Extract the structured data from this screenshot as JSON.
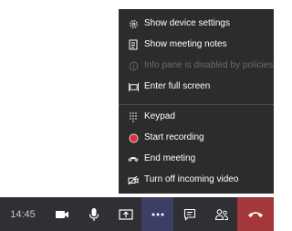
{
  "menu": {
    "items": [
      {
        "label": "Show device settings",
        "icon": "gear-icon",
        "enabled": true
      },
      {
        "label": "Show meeting notes",
        "icon": "notes-icon",
        "enabled": true
      },
      {
        "label": "Info pane is disabled by policies",
        "icon": "info-icon",
        "enabled": false
      },
      {
        "label": "Enter full screen",
        "icon": "fullscreen-icon",
        "enabled": true
      },
      {
        "label": "Keypad",
        "icon": "keypad-icon",
        "enabled": true
      },
      {
        "label": "Start recording",
        "icon": "record-icon",
        "enabled": true
      },
      {
        "label": "End meeting",
        "icon": "end-meeting-icon",
        "enabled": true
      },
      {
        "label": "Turn off incoming video",
        "icon": "video-off-icon",
        "enabled": true
      }
    ]
  },
  "callbar": {
    "time": "14:45",
    "controls": [
      {
        "icon": "camera-icon"
      },
      {
        "icon": "microphone-icon"
      },
      {
        "icon": "share-screen-icon"
      },
      {
        "icon": "more-options-icon"
      },
      {
        "icon": "chat-icon"
      },
      {
        "icon": "participants-icon"
      },
      {
        "icon": "hang-up-icon"
      }
    ]
  },
  "colors": {
    "menu_bg": "#2d2c2c",
    "bar_bg": "#2f2f34",
    "active_bg": "#3d3e66",
    "hangup_bg": "#a4373a",
    "record_dot": "#e0303a"
  }
}
